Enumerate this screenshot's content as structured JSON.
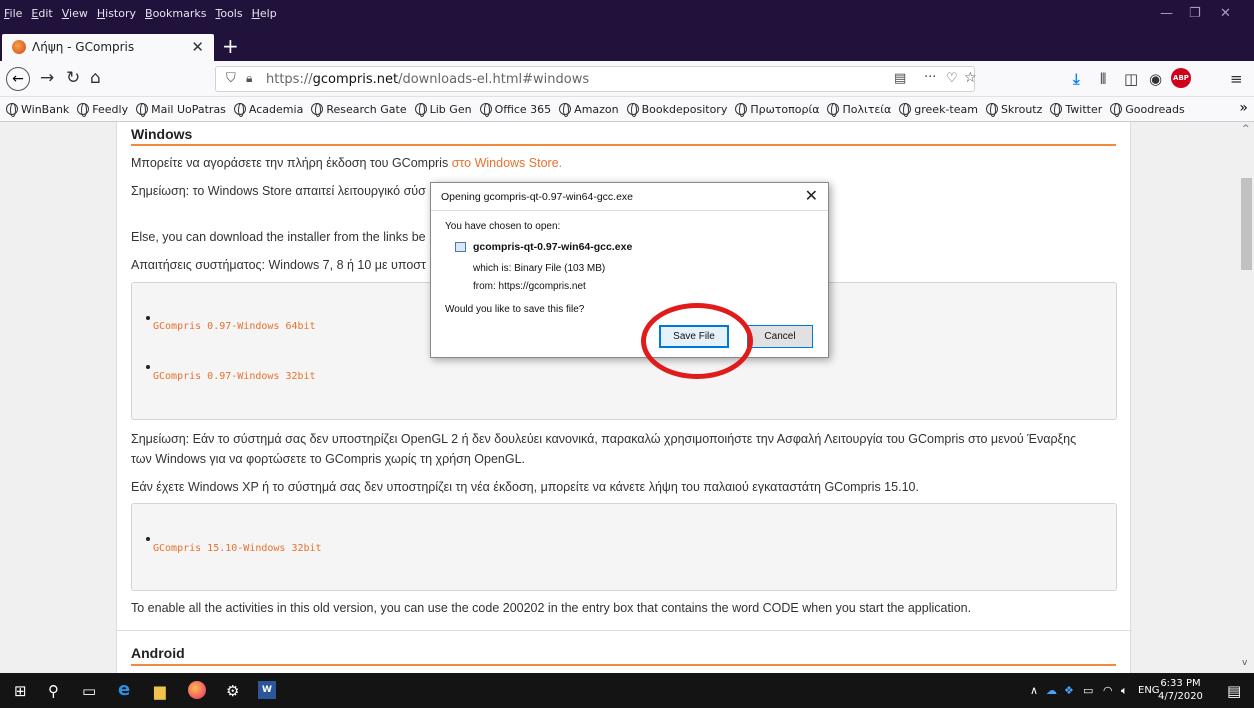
{
  "menu": [
    "File",
    "Edit",
    "View",
    "History",
    "Bookmarks",
    "Tools",
    "Help"
  ],
  "tab": {
    "title": "Λήψη - GCompris"
  },
  "url": {
    "prefix": "https://",
    "host": "gcompris.net",
    "path": "/downloads-el.html#windows"
  },
  "bookmarks": [
    "WinBank",
    "Feedly",
    "Mail UoPatras",
    "Academia",
    "Research Gate",
    "Lib Gen",
    "Office 365",
    "Amazon",
    "Bookdepository",
    "Πρωτοπορία",
    "Πολιτεία",
    "greek-team",
    "Skroutz",
    "Twitter",
    "Goodreads"
  ],
  "page": {
    "windows_heading": "Windows",
    "store_text": "Μπορείτε να αγοράσετε την πλήρη έκδοση του GCompris ",
    "store_link": "στο Windows Store.",
    "note_store": "Σημείωση: το Windows Store απαιτεί λειτουργικό σύσ",
    "else_text": "Else, you can download the installer from the links be",
    "requirements": "Απαιτήσεις συστήματος: Windows 7, 8 ή 10 με υποστ",
    "dl_64": "GCompris 0.97-Windows 64bit",
    "dl_32": "GCompris 0.97-Windows 32bit",
    "note_opengl_1": "Σημείωση: Εάν το σύστημά σας δεν υποστηρίζει OpenGL 2 ή δεν δουλεύει κανονικά, παρακαλώ χρησιμοποιήστε την Ασφαλή Λειτουργία του GCompris στο μενού Έναρξης",
    "note_opengl_2": "των Windows για να φορτώσετε το GCompris χωρίς τη χρήση OpenGL.",
    "xp_text": "Εάν έχετε Windows XP ή το σύστημά σας δεν υποστηρίζει τη νέα έκδοση, μπορείτε να κάνετε λήψη του παλαιού εγκαταστάτη GCompris 15.10.",
    "dl_old": "GCompris 15.10-Windows 32bit",
    "code_text": "To enable all the activities in this old version, you can use the code 200202 in the entry box that contains the word CODE when you start the application.",
    "android_heading": "Android"
  },
  "dialog": {
    "title": "Opening gcompris-qt-0.97-win64-gcc.exe",
    "chosen": "You have chosen to open:",
    "filename": "gcompris-qt-0.97-win64-gcc.exe",
    "which_is": "which is:  Binary File (103 MB)",
    "from": "from:  https://gcompris.net",
    "question": "Would you like to save this file?",
    "save": "Save File",
    "cancel": "Cancel"
  },
  "taskbar": {
    "lang": "ENG",
    "time": "6:33 PM",
    "date": "4/7/2020"
  },
  "colors": {
    "accent": "#e8712d",
    "dialog_focus": "#0078d7",
    "annotation": "#e01b1b"
  }
}
